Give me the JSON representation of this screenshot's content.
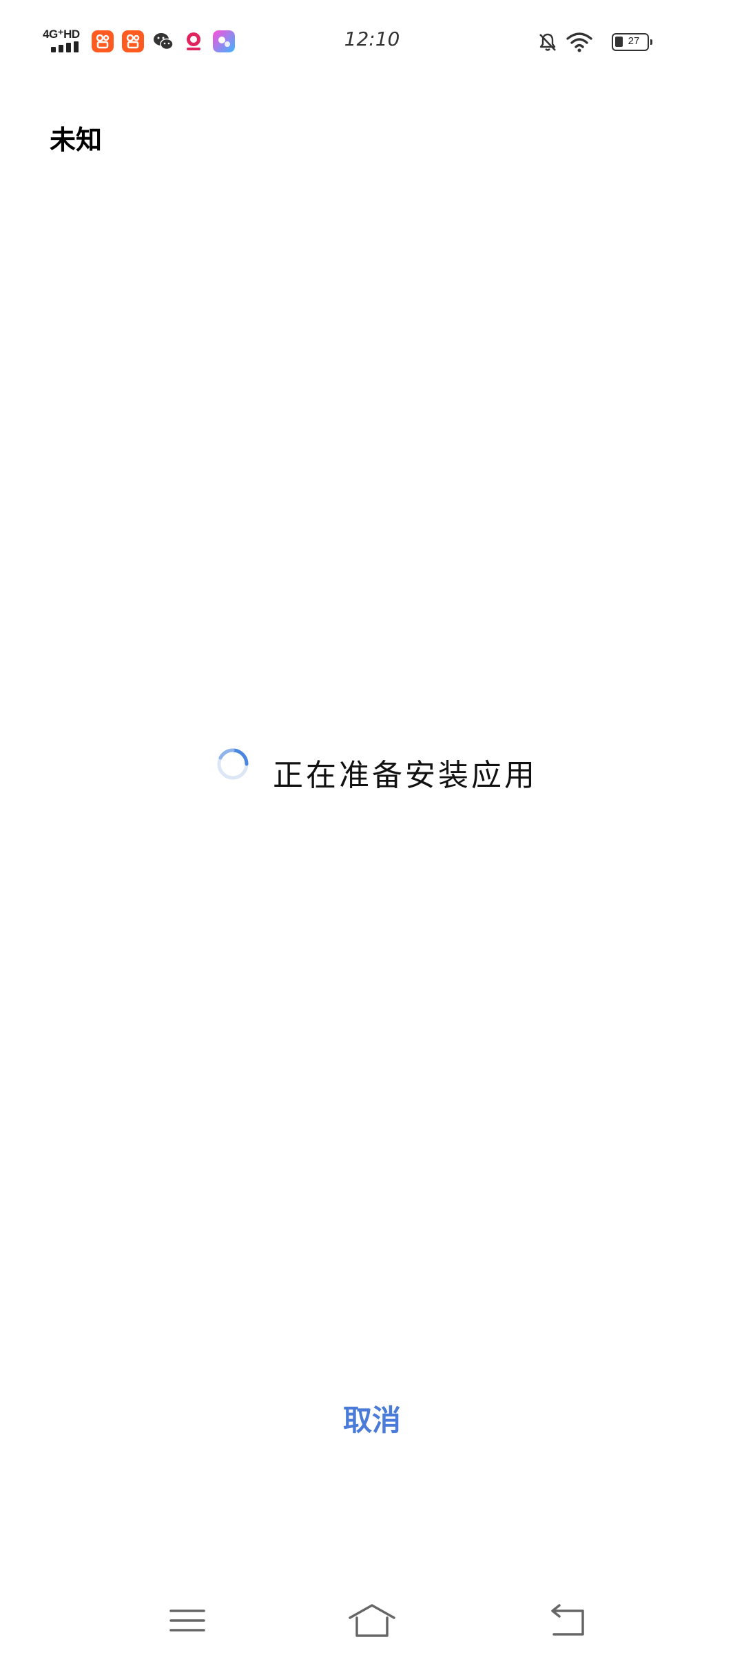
{
  "status_bar": {
    "network": "4G⁺HD",
    "time": "12:10",
    "battery_level": "27",
    "notification_app_icons": [
      "kuaishou-icon",
      "kuaishou-icon",
      "wechat-icon",
      "photo-app-icon",
      "video-app-icon"
    ]
  },
  "header": {
    "app_name": "未知"
  },
  "main": {
    "loading_text": "正在准备安装应用"
  },
  "actions": {
    "cancel_label": "取消"
  },
  "nav": {
    "items": [
      "menu-icon",
      "home-icon",
      "back-icon"
    ]
  },
  "colors": {
    "accent": "#4a7bd8",
    "background": "#ffffff"
  }
}
